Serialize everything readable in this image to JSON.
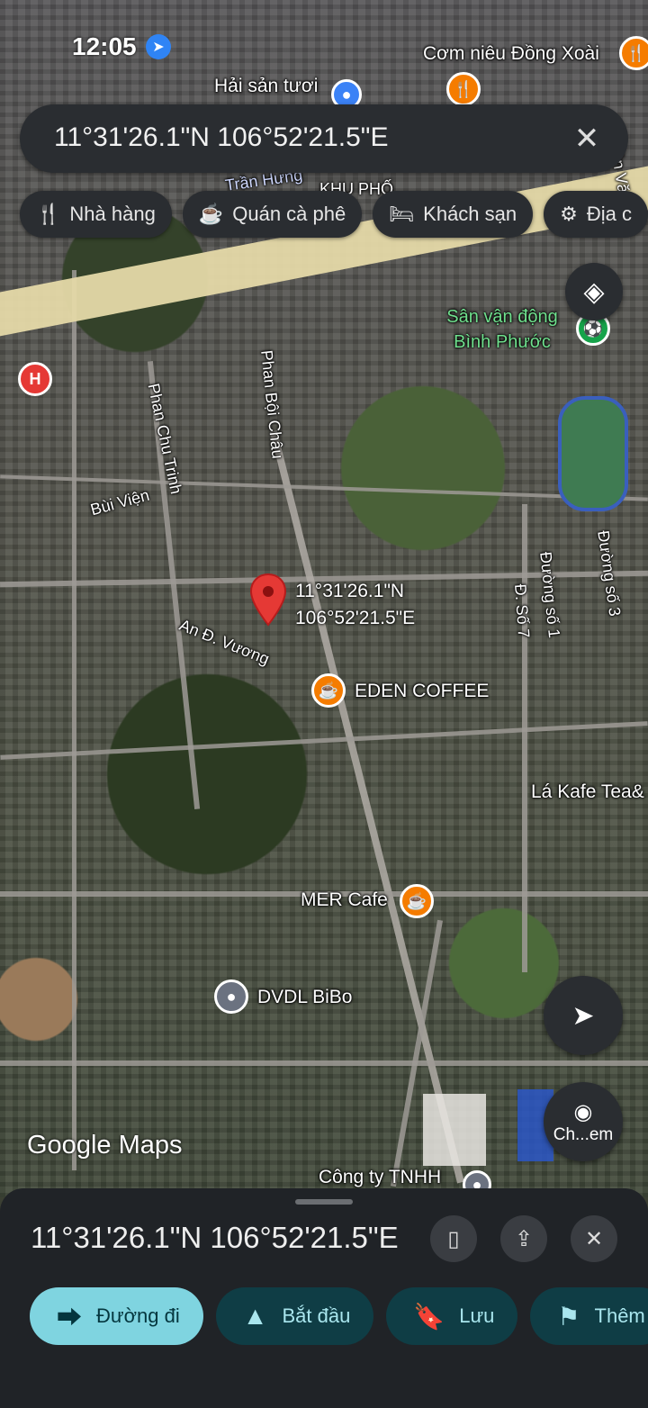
{
  "status": {
    "time": "12:05"
  },
  "search": {
    "query": "11°31'26.1\"N 106°52'21.5\"E"
  },
  "chips": [
    {
      "icon": "restaurant-icon",
      "glyph": "🍴",
      "label": "Nhà hàng"
    },
    {
      "icon": "cafe-icon",
      "glyph": "☕",
      "label": "Quán cà phê"
    },
    {
      "icon": "hotel-icon",
      "glyph": "🛏",
      "label": "Khách sạn"
    },
    {
      "icon": "attraction-icon",
      "glyph": "⚙",
      "label": "Địa c"
    }
  ],
  "map": {
    "labels": {
      "com_nieu": "Cơm niêu Đồng Xoài",
      "hai_san": "Hải sản tươi",
      "tran_hung": "Trần Hưng",
      "khu_pho": "KHU PHỐ",
      "tran_van": "Trần Vă",
      "stadium": "Sân vận động Bình Phước",
      "phan_boi_chau": "Phan Bội Châu",
      "phan_chu_trinh": "Phan Chu Trinh",
      "bui_vien": "Bùi Viện",
      "an_duong_vuong": "An Đ. Vương",
      "duong_so_3": "Đường số 3",
      "duong_so_1": "Đường số 1",
      "d_so_7": "Đ. Số 7",
      "eden": "EDEN COFFEE",
      "la_kafe": "Lá Kafe Tea&",
      "mer": "MER Cafe",
      "bibo": "DVDL BiBo",
      "cong_ty": "Công ty TNHH",
      "hospital": "H"
    },
    "pin": {
      "line1": "11°31'26.1\"N",
      "line2": "106°52'21.5\"E"
    },
    "logo": "Google Maps",
    "screenshot_search": "Ch...em"
  },
  "sheet": {
    "title": "11°31'26.1\"N 106°52'21.5\"E",
    "actions": [
      {
        "icon": "directions-icon",
        "glyph": "⮕",
        "label": "Đường đi"
      },
      {
        "icon": "navigate-icon",
        "glyph": "▲",
        "label": "Bắt đầu"
      },
      {
        "icon": "bookmark-icon",
        "glyph": "🔖",
        "label": "Lưu"
      },
      {
        "icon": "flag-icon",
        "glyph": "⚑",
        "label": "Thêm"
      }
    ]
  },
  "colors": {
    "accent": "#7fd4e0",
    "pin": "#e53935",
    "poi_food": "#f57c00",
    "sheet_bg": "#202327"
  }
}
